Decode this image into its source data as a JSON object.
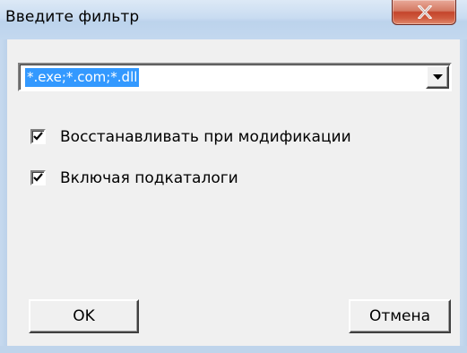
{
  "window": {
    "title": "Введите фильтр",
    "close_glyph": "close-icon"
  },
  "filter": {
    "value": "*.exe;*.com;*.dll",
    "selected": true,
    "dropdown_icon": "chevron-down-icon"
  },
  "options": [
    {
      "label": "Восстанавливать при модификации",
      "checked": true
    },
    {
      "label": "Включая подкаталоги",
      "checked": true
    }
  ],
  "buttons": {
    "ok_label": "OK",
    "cancel_label": "Отмена"
  },
  "colors": {
    "selection": "#3399ff",
    "close_button": "#c4452c",
    "dialog_face": "#f0f0f0"
  }
}
